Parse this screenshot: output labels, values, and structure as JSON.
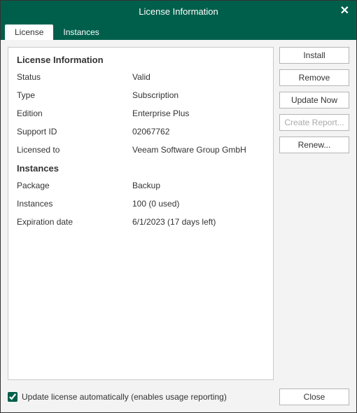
{
  "window": {
    "title": "License Information"
  },
  "tabs": {
    "license": "License",
    "instances": "Instances"
  },
  "license_section": {
    "heading": "License Information",
    "status_label": "Status",
    "status_value": "Valid",
    "type_label": "Type",
    "type_value": "Subscription",
    "edition_label": "Edition",
    "edition_value": "Enterprise Plus",
    "support_id_label": "Support ID",
    "support_id_value": "02067762",
    "licensed_to_label": "Licensed to",
    "licensed_to_value": "Veeam Software Group GmbH"
  },
  "instances_section": {
    "heading": "Instances",
    "package_label": "Package",
    "package_value": "Backup",
    "instances_label": "Instances",
    "instances_value": "100 (0 used)",
    "expiration_label": "Expiration date",
    "expiration_value": "6/1/2023 (17 days left)"
  },
  "buttons": {
    "install": "Install",
    "remove": "Remove",
    "update_now": "Update Now",
    "create_report": "Create Report...",
    "renew": "Renew...",
    "close": "Close"
  },
  "footer": {
    "auto_update_label": "Update license automatically (enables usage reporting)",
    "auto_update_checked": true
  }
}
